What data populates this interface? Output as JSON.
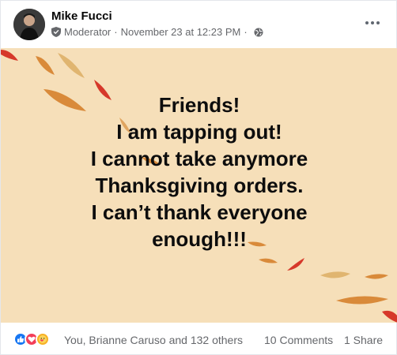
{
  "post": {
    "author": "Mike Fucci",
    "role": "Moderator",
    "separator": "·",
    "timestamp": "November 23 at 12:23 PM",
    "privacy_icon": "globe-icon",
    "menu_icon": "more-options-icon"
  },
  "media": {
    "background_color": "#f6dfb9",
    "lines": [
      "Friends!",
      "I am tapping out!",
      "I cannot take anymore",
      "Thanksgiving orders.",
      "I can’t thank everyone",
      "enough!!!"
    ]
  },
  "footer": {
    "reaction_icons": [
      "like-icon",
      "love-icon",
      "care-icon"
    ],
    "reactions_text": "You, Brianne Caruso and 132 others",
    "comments_text": "10 Comments",
    "shares_text": "1 Share"
  }
}
